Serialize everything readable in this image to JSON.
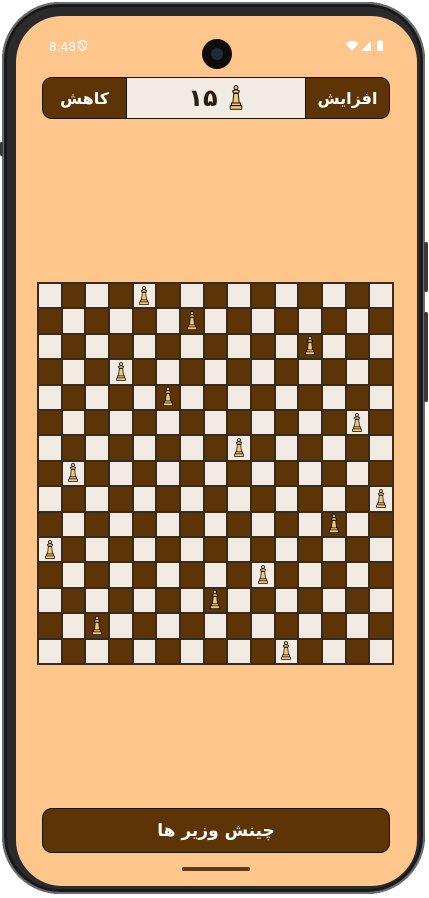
{
  "status_bar": {
    "time": "8:48"
  },
  "header": {
    "decrease_label": "کاهش",
    "increase_label": "افزایش",
    "queen_count": "۱۵"
  },
  "board": {
    "size": 15,
    "light_color": "#f2ebe4",
    "dark_color": "#5c3406",
    "queen_icon": "queen-icon",
    "queen_columns_by_row": [
      4,
      6,
      11,
      3,
      5,
      13,
      8,
      1,
      14,
      12,
      0,
      9,
      7,
      2,
      10
    ]
  },
  "footer": {
    "place_queens_label": "چینش وزیر ها"
  },
  "colors": {
    "background": "#ffc68b",
    "accent": "#5c3406",
    "queen_fill": "#f5c878"
  }
}
